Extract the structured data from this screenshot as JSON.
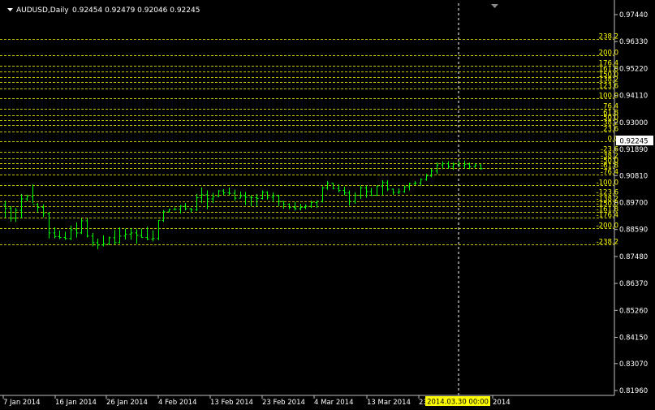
{
  "header": {
    "symbol_label": "AUDUSD,Daily",
    "ohlc": "0.92454 0.92479 0.92046 0.92245"
  },
  "crosshair_label": "2014.03.30 00:00",
  "colors": {
    "background": "#000000",
    "candles": "#00ff00",
    "fib_lines": "#ffff00",
    "axis": "#c0c0c0",
    "text": "#ffffff",
    "price_marker_bg": "#ffffff"
  },
  "chart_data": {
    "type": "ohlc",
    "price_axis": {
      "ylim": [
        0.8164,
        0.9774
      ],
      "ticks": [
        "0.97440",
        "0.96330",
        "0.95220",
        "0.94110",
        "0.93000",
        "0.91890",
        "0.90810",
        "0.89700",
        "0.88590",
        "0.87480",
        "0.86370",
        "0.85260",
        "0.84150",
        "0.83070",
        "0.81960"
      ]
    },
    "time_axis": {
      "tick_labels": [
        "7 Jan 2014",
        "16 Jan 2014",
        "26 Jan 2014",
        "4 Feb 2014",
        "13 Feb 2014",
        "23 Feb 2014",
        "4 Mar 2014",
        "13 Mar 2014",
        "23",
        "2014"
      ]
    },
    "current_price": "0.92245",
    "fib_levels": [
      {
        "label": "238.2",
        "price": 0.9645
      },
      {
        "label": "200.0",
        "price": 0.9577
      },
      {
        "label": "176.4",
        "price": 0.9535
      },
      {
        "label": "161.8",
        "price": 0.9509
      },
      {
        "label": "150.0",
        "price": 0.9488
      },
      {
        "label": "138.2",
        "price": 0.9467
      },
      {
        "label": "123.6",
        "price": 0.9441
      },
      {
        "label": "100.0",
        "price": 0.9399
      },
      {
        "label": "76.4",
        "price": 0.9357
      },
      {
        "label": "61.8",
        "price": 0.9331
      },
      {
        "label": "50.0",
        "price": 0.931
      },
      {
        "label": "38.2",
        "price": 0.9289
      },
      {
        "label": "23.6",
        "price": 0.9263
      },
      {
        "label": "0.0",
        "price": 0.9221
      },
      {
        "label": "-23.6",
        "price": 0.9179
      },
      {
        "label": "-38.2",
        "price": 0.9153
      },
      {
        "label": "-50.0",
        "price": 0.9132
      },
      {
        "label": "-61.8",
        "price": 0.9111
      },
      {
        "label": "-76.4",
        "price": 0.9085
      },
      {
        "label": "-100.0",
        "price": 0.9043
      },
      {
        "label": "-123.6",
        "price": 0.9001
      },
      {
        "label": "-138.2",
        "price": 0.8975
      },
      {
        "label": "-150.0",
        "price": 0.8954
      },
      {
        "label": "-161.8",
        "price": 0.8933
      },
      {
        "label": "-176.4",
        "price": 0.8907
      },
      {
        "label": "-200.0",
        "price": 0.8865
      },
      {
        "label": "-238.2",
        "price": 0.8797
      }
    ],
    "bars": [
      {
        "o": 0.896,
        "h": 0.8978,
        "l": 0.8908,
        "c": 0.8946
      },
      {
        "o": 0.8946,
        "h": 0.8955,
        "l": 0.8892,
        "c": 0.8905
      },
      {
        "o": 0.8905,
        "h": 0.8948,
        "l": 0.889,
        "c": 0.8938
      },
      {
        "o": 0.8938,
        "h": 0.9005,
        "l": 0.8905,
        "c": 0.8985
      },
      {
        "o": 0.8985,
        "h": 0.9003,
        "l": 0.8975,
        "c": 0.8995
      },
      {
        "o": 0.8995,
        "h": 0.9045,
        "l": 0.8968,
        "c": 0.8962
      },
      {
        "o": 0.8962,
        "h": 0.8968,
        "l": 0.893,
        "c": 0.895
      },
      {
        "o": 0.895,
        "h": 0.8963,
        "l": 0.891,
        "c": 0.8925
      },
      {
        "o": 0.8925,
        "h": 0.893,
        "l": 0.8822,
        "c": 0.8845
      },
      {
        "o": 0.8845,
        "h": 0.8868,
        "l": 0.8822,
        "c": 0.883
      },
      {
        "o": 0.883,
        "h": 0.8855,
        "l": 0.882,
        "c": 0.8826
      },
      {
        "o": 0.8826,
        "h": 0.885,
        "l": 0.8816,
        "c": 0.8822
      },
      {
        "o": 0.8822,
        "h": 0.8875,
        "l": 0.8815,
        "c": 0.8858
      },
      {
        "o": 0.8858,
        "h": 0.8888,
        "l": 0.8826,
        "c": 0.8845
      },
      {
        "o": 0.8845,
        "h": 0.8905,
        "l": 0.884,
        "c": 0.8895
      },
      {
        "o": 0.8895,
        "h": 0.8905,
        "l": 0.8826,
        "c": 0.8832
      },
      {
        "o": 0.8832,
        "h": 0.8845,
        "l": 0.879,
        "c": 0.8805
      },
      {
        "o": 0.8805,
        "h": 0.8822,
        "l": 0.8778,
        "c": 0.8795
      },
      {
        "o": 0.8795,
        "h": 0.8835,
        "l": 0.879,
        "c": 0.88
      },
      {
        "o": 0.88,
        "h": 0.883,
        "l": 0.8795,
        "c": 0.8825
      },
      {
        "o": 0.8825,
        "h": 0.8857,
        "l": 0.8797,
        "c": 0.8805
      },
      {
        "o": 0.8805,
        "h": 0.8868,
        "l": 0.8802,
        "c": 0.8832
      },
      {
        "o": 0.8832,
        "h": 0.8862,
        "l": 0.8818,
        "c": 0.884
      },
      {
        "o": 0.884,
        "h": 0.8865,
        "l": 0.8817,
        "c": 0.8845
      },
      {
        "o": 0.8845,
        "h": 0.886,
        "l": 0.88,
        "c": 0.8835
      },
      {
        "o": 0.8835,
        "h": 0.8862,
        "l": 0.8826,
        "c": 0.8826
      },
      {
        "o": 0.8826,
        "h": 0.887,
        "l": 0.8815,
        "c": 0.882
      },
      {
        "o": 0.882,
        "h": 0.8855,
        "l": 0.881,
        "c": 0.8822
      },
      {
        "o": 0.8822,
        "h": 0.8898,
        "l": 0.8815,
        "c": 0.8897
      },
      {
        "o": 0.8897,
        "h": 0.894,
        "l": 0.889,
        "c": 0.8932
      },
      {
        "o": 0.8932,
        "h": 0.8945,
        "l": 0.893,
        "c": 0.8942
      },
      {
        "o": 0.8942,
        "h": 0.895,
        "l": 0.8938,
        "c": 0.8942
      },
      {
        "o": 0.8942,
        "h": 0.896,
        "l": 0.8925,
        "c": 0.8955
      },
      {
        "o": 0.8955,
        "h": 0.8968,
        "l": 0.8938,
        "c": 0.8945
      },
      {
        "o": 0.8945,
        "h": 0.8948,
        "l": 0.8928,
        "c": 0.894
      },
      {
        "o": 0.894,
        "h": 0.9005,
        "l": 0.8935,
        "c": 0.899
      },
      {
        "o": 0.899,
        "h": 0.9032,
        "l": 0.8968,
        "c": 0.9002
      },
      {
        "o": 0.9002,
        "h": 0.902,
        "l": 0.8943,
        "c": 0.8985
      },
      {
        "o": 0.8985,
        "h": 0.901,
        "l": 0.8968,
        "c": 0.8995
      },
      {
        "o": 0.8995,
        "h": 0.9022,
        "l": 0.8992,
        "c": 0.9018
      },
      {
        "o": 0.9018,
        "h": 0.9025,
        "l": 0.9,
        "c": 0.901
      },
      {
        "o": 0.901,
        "h": 0.9032,
        "l": 0.9,
        "c": 0.9008
      },
      {
        "o": 0.9008,
        "h": 0.9023,
        "l": 0.8978,
        "c": 0.8988
      },
      {
        "o": 0.8988,
        "h": 0.9015,
        "l": 0.8988,
        "c": 0.8998
      },
      {
        "o": 0.8998,
        "h": 0.9013,
        "l": 0.896,
        "c": 0.8992
      },
      {
        "o": 0.8992,
        "h": 0.9,
        "l": 0.8955,
        "c": 0.899
      },
      {
        "o": 0.899,
        "h": 0.9005,
        "l": 0.8955,
        "c": 0.8987
      },
      {
        "o": 0.8987,
        "h": 0.902,
        "l": 0.8983,
        "c": 0.9012
      },
      {
        "o": 0.9012,
        "h": 0.9017,
        "l": 0.8982,
        "c": 0.8992
      },
      {
        "o": 0.8992,
        "h": 0.9012,
        "l": 0.8972,
        "c": 0.8998
      },
      {
        "o": 0.8998,
        "h": 0.9002,
        "l": 0.8955,
        "c": 0.8975
      },
      {
        "o": 0.8975,
        "h": 0.8975,
        "l": 0.8945,
        "c": 0.8963
      },
      {
        "o": 0.8963,
        "h": 0.8967,
        "l": 0.8943,
        "c": 0.895
      },
      {
        "o": 0.895,
        "h": 0.8972,
        "l": 0.8938,
        "c": 0.8945
      },
      {
        "o": 0.8945,
        "h": 0.8965,
        "l": 0.8938,
        "c": 0.895
      },
      {
        "o": 0.895,
        "h": 0.8963,
        "l": 0.8943,
        "c": 0.8955
      },
      {
        "o": 0.8955,
        "h": 0.8978,
        "l": 0.8948,
        "c": 0.897
      },
      {
        "o": 0.897,
        "h": 0.8978,
        "l": 0.8948,
        "c": 0.8975
      },
      {
        "o": 0.8975,
        "h": 0.9037,
        "l": 0.897,
        "c": 0.903
      },
      {
        "o": 0.903,
        "h": 0.9058,
        "l": 0.9023,
        "c": 0.905
      },
      {
        "o": 0.905,
        "h": 0.905,
        "l": 0.9025,
        "c": 0.9028
      },
      {
        "o": 0.9028,
        "h": 0.9045,
        "l": 0.9012,
        "c": 0.902
      },
      {
        "o": 0.902,
        "h": 0.9035,
        "l": 0.9,
        "c": 0.901
      },
      {
        "o": 0.901,
        "h": 0.902,
        "l": 0.8958,
        "c": 0.8975
      },
      {
        "o": 0.8975,
        "h": 0.9012,
        "l": 0.8965,
        "c": 0.9
      },
      {
        "o": 0.9,
        "h": 0.904,
        "l": 0.8985,
        "c": 0.903
      },
      {
        "o": 0.903,
        "h": 0.904,
        "l": 0.899,
        "c": 0.9015
      },
      {
        "o": 0.9015,
        "h": 0.903,
        "l": 0.8997,
        "c": 0.9
      },
      {
        "o": 0.9,
        "h": 0.904,
        "l": 0.8998,
        "c": 0.9038
      },
      {
        "o": 0.9038,
        "h": 0.9062,
        "l": 0.9,
        "c": 0.9052
      },
      {
        "o": 0.9052,
        "h": 0.9062,
        "l": 0.9018,
        "c": 0.9025
      },
      {
        "o": 0.9025,
        "h": 0.9027,
        "l": 0.9002,
        "c": 0.9012
      },
      {
        "o": 0.9012,
        "h": 0.9028,
        "l": 0.9005,
        "c": 0.9015
      },
      {
        "o": 0.9015,
        "h": 0.904,
        "l": 0.901,
        "c": 0.9035
      },
      {
        "o": 0.9035,
        "h": 0.9052,
        "l": 0.902,
        "c": 0.9048
      },
      {
        "o": 0.9048,
        "h": 0.9058,
        "l": 0.9042,
        "c": 0.905
      },
      {
        "o": 0.905,
        "h": 0.907,
        "l": 0.904,
        "c": 0.9065
      },
      {
        "o": 0.9065,
        "h": 0.9088,
        "l": 0.906,
        "c": 0.908
      },
      {
        "o": 0.908,
        "h": 0.911,
        "l": 0.9075,
        "c": 0.91
      },
      {
        "o": 0.91,
        "h": 0.9135,
        "l": 0.9088,
        "c": 0.9125
      },
      {
        "o": 0.9125,
        "h": 0.914,
        "l": 0.9108,
        "c": 0.913
      },
      {
        "o": 0.913,
        "h": 0.914,
        "l": 0.911,
        "c": 0.9118
      },
      {
        "o": 0.9118,
        "h": 0.9135,
        "l": 0.9105,
        "c": 0.9128
      },
      {
        "o": 0.9128,
        "h": 0.914,
        "l": 0.9115,
        "c": 0.9122
      },
      {
        "o": 0.9122,
        "h": 0.9143,
        "l": 0.911,
        "c": 0.9128
      },
      {
        "o": 0.9128,
        "h": 0.9135,
        "l": 0.9108,
        "c": 0.9118
      },
      {
        "o": 0.9118,
        "h": 0.913,
        "l": 0.9113,
        "c": 0.9125
      },
      {
        "o": 0.9125,
        "h": 0.9128,
        "l": 0.9105,
        "c": 0.911
      }
    ]
  }
}
